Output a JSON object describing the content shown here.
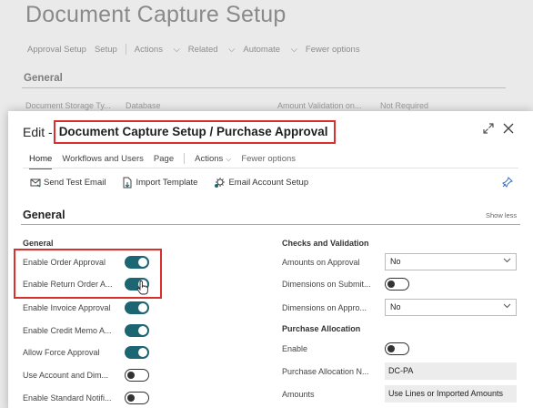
{
  "background": {
    "title": "Document Capture Setup",
    "nav": {
      "approval_setup": "Approval Setup",
      "setup": "Setup",
      "actions": "Actions",
      "related": "Related",
      "automate": "Automate",
      "fewer_options": "Fewer options"
    },
    "section": "General",
    "fields": {
      "storage_label": "Document Storage Ty...",
      "storage_value": "Database",
      "amount_validation_label": "Amount Validation on...",
      "amount_validation_value": "Not Required"
    }
  },
  "modal": {
    "edit_prefix": "Edit -",
    "title": "Document Capture Setup / Purchase Approval",
    "tabs": {
      "home": "Home",
      "workflows": "Workflows and Users",
      "page": "Page",
      "actions": "Actions",
      "fewer_options": "Fewer options"
    },
    "toolbar": {
      "send_test_email": "Send Test Email",
      "import_template": "Import Template",
      "email_account_setup": "Email Account Setup"
    },
    "section_title": "General",
    "show_less": "Show less",
    "left_column": {
      "header": "General",
      "fields": [
        {
          "label": "Enable Order Approval",
          "state": "on"
        },
        {
          "label": "Enable Return Order A...",
          "state": "on"
        },
        {
          "label": "Enable Invoice Approval",
          "state": "on"
        },
        {
          "label": "Enable Credit Memo A...",
          "state": "on"
        },
        {
          "label": "Allow Force Approval",
          "state": "on"
        },
        {
          "label": "Use Account and Dim...",
          "state": "off"
        },
        {
          "label": "Enable Standard Notifi...",
          "state": "off"
        }
      ]
    },
    "right_column": {
      "checks_header": "Checks and Validation",
      "amounts_on_approval_label": "Amounts on Approval",
      "amounts_on_approval_value": "No",
      "dimensions_on_submit_label": "Dimensions on Submit...",
      "dimensions_on_approval_label": "Dimensions on Appro...",
      "dimensions_on_approval_value": "No",
      "allocation_header": "Purchase Allocation",
      "enable_label": "Enable",
      "allocation_no_label": "Purchase Allocation N...",
      "allocation_no_value": "DC-PA",
      "amounts_label": "Amounts",
      "amounts_value": "Use Lines or Imported Amounts"
    }
  }
}
